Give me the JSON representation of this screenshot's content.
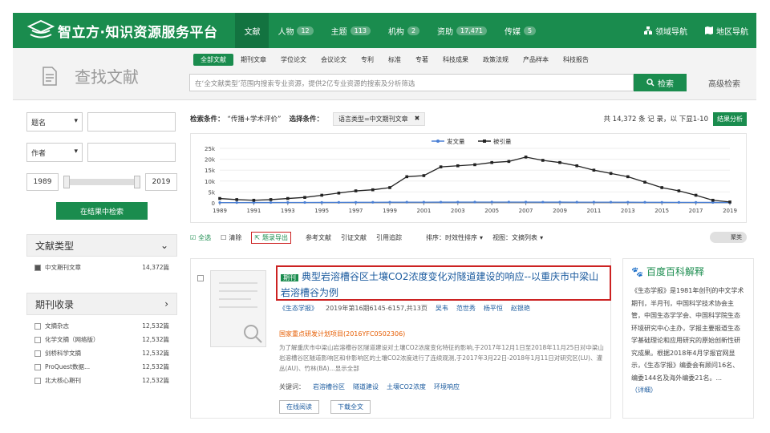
{
  "header": {
    "logo_text": "智立方·知识资源服务平台",
    "nav": [
      {
        "label": "文献",
        "count": "",
        "active": true
      },
      {
        "label": "人物",
        "count": "12"
      },
      {
        "label": "主题",
        "count": "113"
      },
      {
        "label": "机构",
        "count": "2"
      },
      {
        "label": "资助",
        "count": "17,471"
      },
      {
        "label": "传媒",
        "count": "5"
      }
    ],
    "right_nav": [
      "领域导航",
      "地区导航"
    ]
  },
  "search": {
    "title": "查找文献",
    "tabs": [
      "全部文献",
      "期刊文章",
      "学位论文",
      "会议论文",
      "专利",
      "标准",
      "专著",
      "科技成果",
      "政策法规",
      "产品样本",
      "科技报告"
    ],
    "placeholder": "在‘全文献类型’范围内搜索专业资源，提供2亿专业资源的搜索及分析筛选",
    "button": "检索",
    "advanced": "高级检索"
  },
  "filters": {
    "field1": "题名",
    "field2": "作者",
    "year_from": "1989",
    "year_to": "2019",
    "button": "在结果中检索"
  },
  "doc_type_panel": {
    "title": "文献类型",
    "items": [
      {
        "label": "中文期刊文章",
        "count": "14,372篇"
      }
    ]
  },
  "journal_panel": {
    "title": "期刊收录",
    "items": [
      {
        "label": "文摘杂志",
        "count": "12,532篇"
      },
      {
        "label": "化学文摘（网络版）",
        "count": "12,532篇"
      },
      {
        "label": "剑桥科学文摘",
        "count": "12,532篇"
      },
      {
        "label": "ProQuest数据...",
        "count": "12,532篇"
      },
      {
        "label": "北大核心期刊",
        "count": "12,532篇"
      }
    ]
  },
  "criteria": {
    "label": "检索条件：",
    "value": "“传播+学术评价”",
    "select_label": "选择条件：",
    "tag": "语言类型=中文期刊文章",
    "total": "共 14,372 条 记 录，以 下显1-10",
    "analysis_button": "结果分析"
  },
  "chart_data": {
    "type": "line",
    "legend": [
      "发文量",
      "被引量"
    ],
    "x": [
      1989,
      1990,
      1991,
      1992,
      1993,
      1994,
      1995,
      1996,
      1997,
      1998,
      1999,
      2000,
      2001,
      2002,
      2003,
      2004,
      2005,
      2006,
      2007,
      2008,
      2009,
      2010,
      2011,
      2012,
      2013,
      2014,
      2015,
      2016,
      2017,
      2018,
      2019
    ],
    "x_ticks": [
      "1989",
      "1991",
      "1993",
      "1995",
      "1997",
      "1999",
      "2001",
      "2003",
      "2005",
      "2007",
      "2009",
      "2011",
      "2013",
      "2015",
      "2017",
      "2019"
    ],
    "y_ticks": [
      "0",
      "5k",
      "10k",
      "15k",
      "20k",
      "25k"
    ],
    "ylim": [
      0,
      25000
    ],
    "series": [
      {
        "name": "发文量",
        "values": [
          150,
          150,
          160,
          170,
          180,
          190,
          200,
          220,
          250,
          280,
          300,
          320,
          330,
          340,
          350,
          360,
          360,
          360,
          360,
          350,
          340,
          330,
          320,
          310,
          300,
          280,
          260,
          240,
          220,
          200,
          150
        ]
      },
      {
        "name": "被引量",
        "values": [
          2000,
          1500,
          1200,
          1500,
          2000,
          2500,
          3500,
          4500,
          5500,
          6000,
          7000,
          12000,
          12500,
          16500,
          17000,
          17500,
          18500,
          19000,
          21000,
          19500,
          18500,
          17000,
          15000,
          13500,
          12000,
          9500,
          7000,
          5500,
          3500,
          1200,
          400
        ]
      }
    ]
  },
  "toolbar": {
    "items": [
      "全选",
      "清除",
      "题录导出",
      "参考文献",
      "引证文献",
      "引用追踪",
      "排序：时效性排序",
      "视图：文摘列表"
    ],
    "toggle": "聚类"
  },
  "result": {
    "badge": "期刊",
    "title": "典型岩溶槽谷区土壤CO2浓度变化对隧道建设的响应--以重庆市中梁山岩溶槽谷为例",
    "meta": [
      "《生态学报》",
      "2019年第16期6145-6157,共13页",
      "吴韦",
      "范世秀",
      "杨平恒",
      "赵银艳"
    ],
    "fund": "国家重点研发计划项目(2016YFC0502306)",
    "abstract": "为了解重庆市中梁山岩溶槽谷区隧道建设对土壤CO2浓度变化特征的影响,于2017年12月1日至2018年11月25日对中梁山岩溶槽谷区隧道影响区和非影响区的土壤CO2浓度进行了连续观测,于2017年3月22日-2018年1月11日对研究区(LU)、灌丛(AU)、竹林(BA)...显示全部",
    "keywords_label": "关键词：",
    "keywords": [
      "岩溶槽谷区",
      "隧道建设",
      "土壤CO2浓度",
      "环境响应"
    ],
    "actions": [
      "在线阅读",
      "下载全文"
    ]
  },
  "baike": {
    "title": "百度百科解释",
    "text": "《生态学报》是1981年创刊的中文学术期刊，半月刊，中国科学技术协会主管，中国生态学学会、中国科学院生态环境研究中心主办，学报主要报道生态学基础理论和应用研究的原始创新性研究成果。根据2018年4月学报官网显示，《生态学报》编委会有顾问16名、编委144名及海外编委21名。...",
    "link": "（详细）"
  }
}
